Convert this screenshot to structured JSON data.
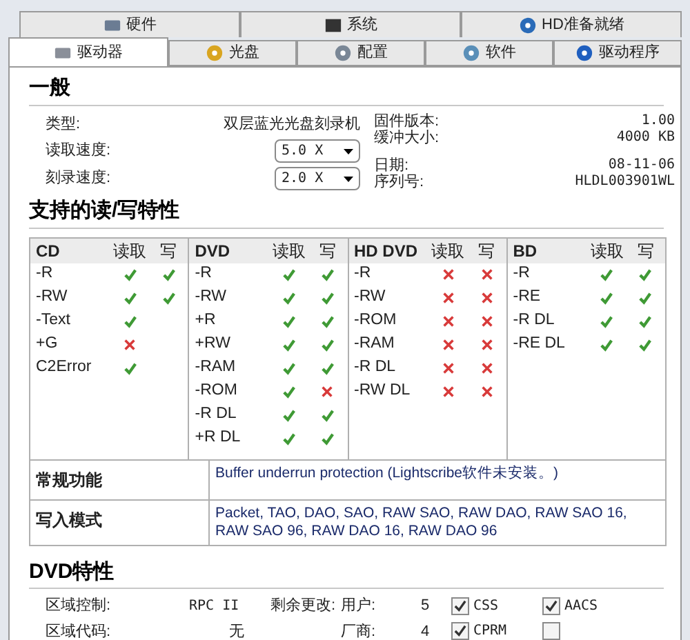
{
  "tabs_top": [
    {
      "label": "硬件",
      "kind": "hardware"
    },
    {
      "label": "系统",
      "kind": "system"
    },
    {
      "label": "HD准备就绪",
      "kind": "hd"
    }
  ],
  "tabs": [
    {
      "label": "驱动器",
      "kind": "drive",
      "selected": true
    },
    {
      "label": "光盘",
      "kind": "disc",
      "selected": false
    },
    {
      "label": "配置",
      "kind": "gear",
      "selected": false
    },
    {
      "label": "软件",
      "kind": "software",
      "selected": false
    },
    {
      "label": "驱动程序",
      "kind": "info",
      "selected": false
    }
  ],
  "general": {
    "title": "一般",
    "type_label": "类型:",
    "type_value": "双层蓝光光盘刻录机",
    "read_speed_label": "读取速度:",
    "read_speed": "5.0 X",
    "write_speed_label": "刻录速度:",
    "write_speed": "2.0 X",
    "right": [
      {
        "label": "固件版本:",
        "value": "1.00"
      },
      {
        "label": "缓冲大小:",
        "value": "4000 KB"
      },
      {
        "label": "日期:",
        "value": "08-11-06"
      },
      {
        "label": "序列号:",
        "value": "HLDL003901WL"
      }
    ]
  },
  "features": {
    "title": "支持的读/写特性",
    "groups": [
      {
        "name": "CD",
        "read_header": "读取",
        "write_header": "写",
        "rows": [
          {
            "label": "-R",
            "read": true,
            "write": true
          },
          {
            "label": "-RW",
            "read": true,
            "write": true
          },
          {
            "label": "-Text",
            "read": true
          },
          {
            "label": "+G",
            "read": false
          },
          {
            "label": "C2Error",
            "read": true
          }
        ]
      },
      {
        "name": "DVD",
        "read_header": "读取",
        "write_header": "写",
        "rows": [
          {
            "label": "-R",
            "read": true,
            "write": true
          },
          {
            "label": "-RW",
            "read": true,
            "write": true
          },
          {
            "label": "+R",
            "read": true,
            "write": true
          },
          {
            "label": "+RW",
            "read": true,
            "write": true
          },
          {
            "label": "-RAM",
            "read": true,
            "write": true
          },
          {
            "label": "-ROM",
            "read": true,
            "write": false
          },
          {
            "label": "-R DL",
            "read": true,
            "write": true
          },
          {
            "label": "+R DL",
            "read": true,
            "write": true
          }
        ]
      },
      {
        "name": "HD DVD",
        "read_header": "读取",
        "write_header": "写",
        "rows": [
          {
            "label": "-R",
            "read": false,
            "write": false
          },
          {
            "label": "-RW",
            "read": false,
            "write": false
          },
          {
            "label": "-ROM",
            "read": false,
            "write": false
          },
          {
            "label": "-RAM",
            "read": false,
            "write": false
          },
          {
            "label": "-R DL",
            "read": false,
            "write": false
          },
          {
            "label": "-RW DL",
            "read": false,
            "write": false
          }
        ]
      },
      {
        "name": "BD",
        "read_header": "读取",
        "write_header": "写",
        "rows": [
          {
            "label": "-R",
            "read": true,
            "write": true
          },
          {
            "label": "-RE",
            "read": true,
            "write": true
          },
          {
            "label": "-R DL",
            "read": true,
            "write": true
          },
          {
            "label": "-RE DL",
            "read": true,
            "write": true
          }
        ]
      }
    ],
    "info_rows": [
      {
        "label": "常规功能",
        "value": "Buffer underrun protection (Lightscribe软件未安装。)"
      },
      {
        "label": "写入模式",
        "value": "Packet, TAO, DAO, SAO, RAW SAO, RAW DAO, RAW SAO 16, RAW SAO 96, RAW DAO 16, RAW DAO 96"
      }
    ]
  },
  "dvd": {
    "title": "DVD特性",
    "region_control_label": "区域控制:",
    "region_control": "RPC II",
    "region_code_label": "区域代码:",
    "region_code": "无",
    "changes_label": "剩余更改:",
    "user_label": "用户:",
    "user_value": "5",
    "vendor_label": "厂商:",
    "vendor_value": "4",
    "checks": [
      {
        "label": "CSS",
        "checked": true
      },
      {
        "label": "AACS",
        "checked": true
      },
      {
        "label": "CPRM",
        "checked": true
      },
      {
        "checked": false
      }
    ]
  }
}
